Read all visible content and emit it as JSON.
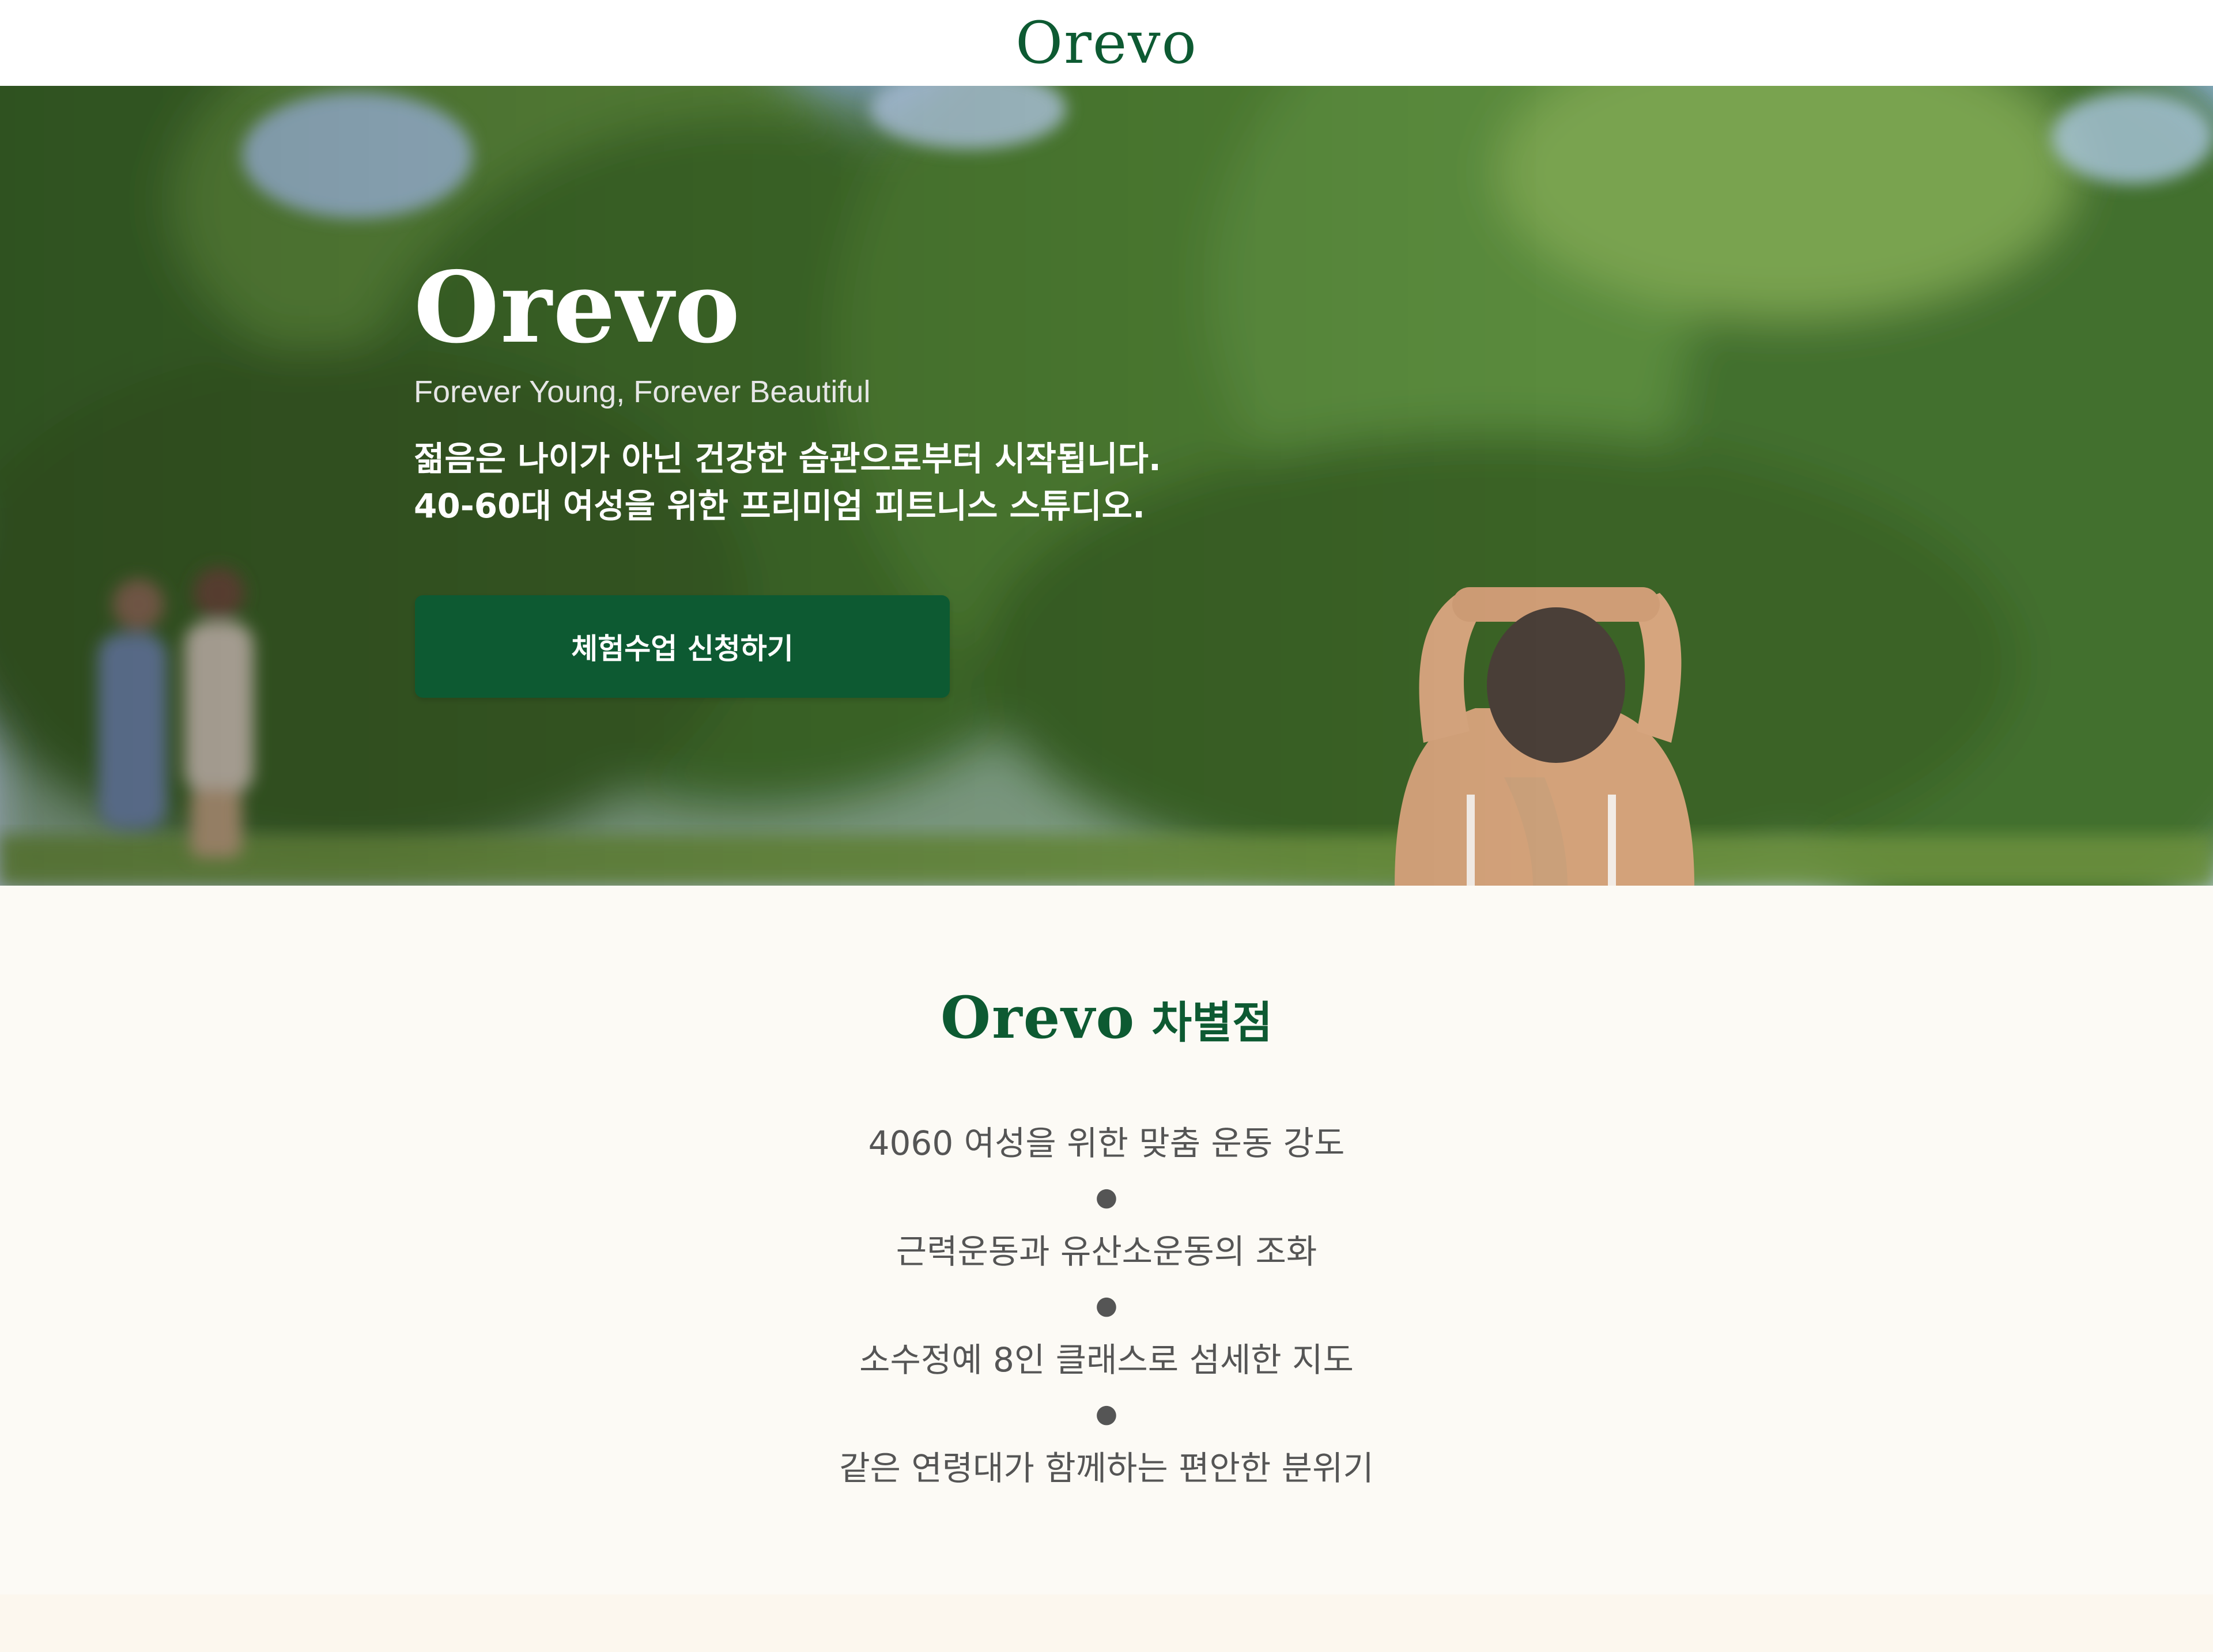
{
  "header": {
    "logo": "Orevo"
  },
  "hero": {
    "title": "Orevo",
    "tagline": "Forever Young, Forever Beautiful",
    "description_line1": "젊음은 나이가 아닌 건강한 습관으로부터 시작됩니다.",
    "description_line2": "40-60대 여성을 위한 프리미엄 피트니스 스튜디오.",
    "cta_label": "체험수업 신청하기"
  },
  "features": {
    "heading_brand": "Orevo",
    "heading_suffix": "차별점",
    "bullet": "●",
    "items": [
      "4060 여성을 위한 맞춤 운동 강도",
      "근력운동과 유산소운동의 조화",
      "소수정예 8인 클래스로 섬세한 지도",
      "같은 연령대가 함께하는 편안한 분위기"
    ]
  },
  "colors": {
    "brand_green": "#0d5a32",
    "background_cream": "#fcfaf5",
    "feature_text": "#555555"
  }
}
